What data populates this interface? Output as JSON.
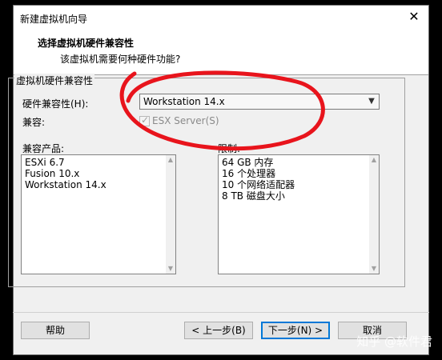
{
  "window": {
    "title": "新建虚拟机向导",
    "close_glyph": "✕"
  },
  "header": {
    "title": "选择虚拟机硬件兼容性",
    "subtitle": "该虚拟机需要何种硬件功能?"
  },
  "group": {
    "legend": "虚拟机硬件兼容性",
    "hardware_label": "硬件兼容性(H):",
    "hardware_value": "Workstation 14.x",
    "compat_label": "兼容:",
    "esx_label": "ESX Server(S)",
    "esx_checked": true,
    "products_label": "兼容产品:",
    "products": [
      "ESXi 6.7",
      "Fusion 10.x",
      "Workstation 14.x"
    ],
    "limits_label": "限制:",
    "limits": [
      "64 GB 内存",
      "16 个处理器",
      "10 个网络适配器",
      "8 TB 磁盘大小"
    ]
  },
  "buttons": {
    "help": "帮助",
    "back": "< 上一步(B)",
    "next": "下一步(N) >",
    "cancel": "取消"
  },
  "annotation": {
    "color": "#e8141c"
  },
  "watermark": "知乎 @软件君"
}
